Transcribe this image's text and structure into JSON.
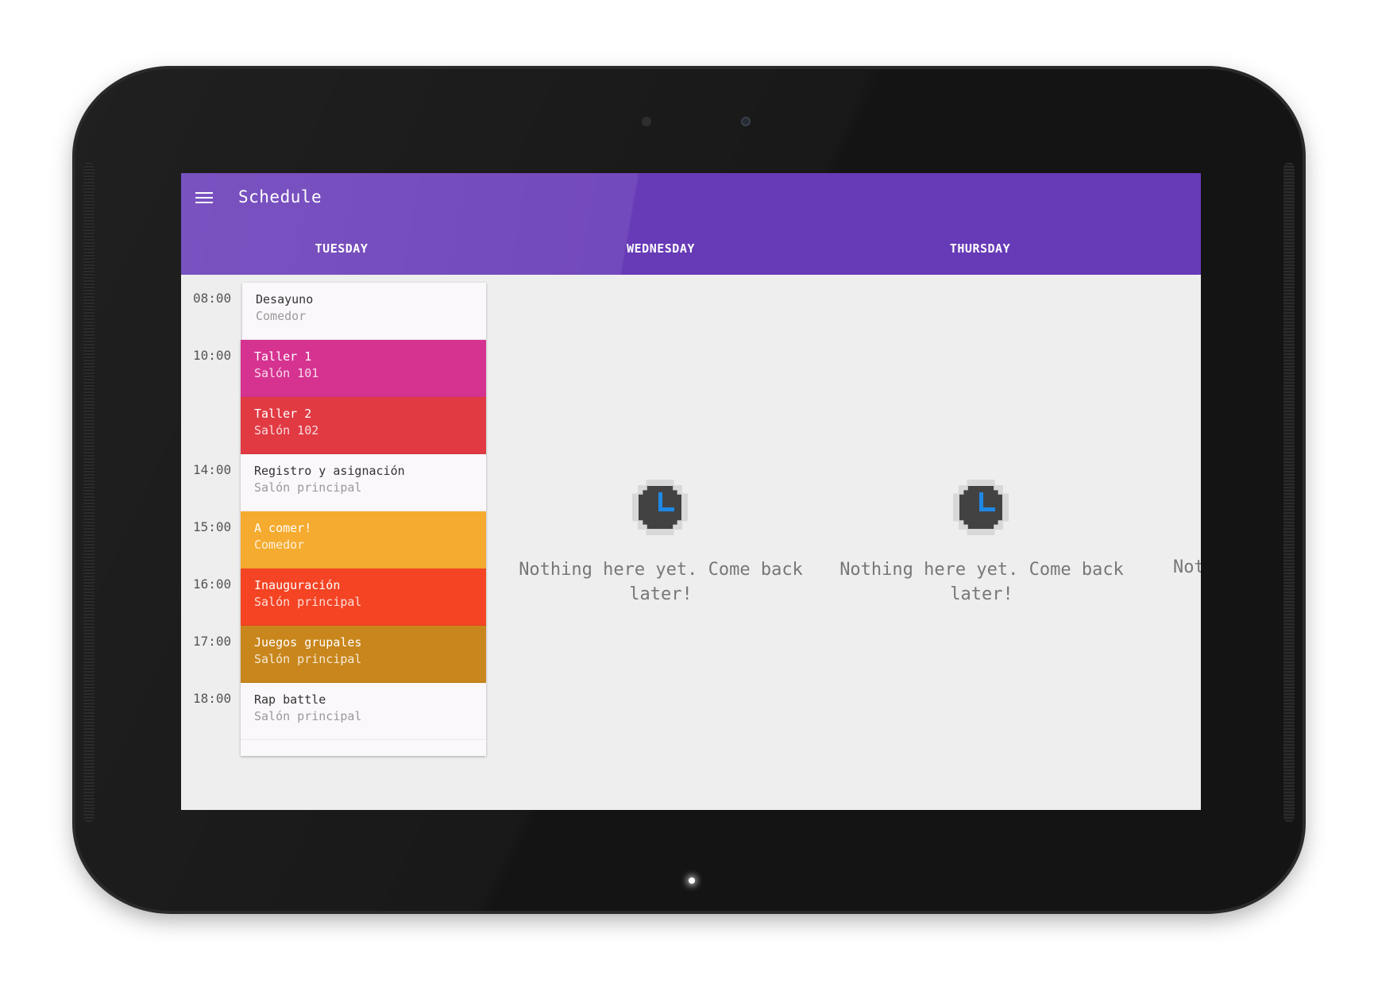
{
  "app": {
    "title": "Schedule",
    "menu_icon": "hamburger-menu-icon",
    "accent_color": "#673ab7"
  },
  "tabs": [
    {
      "label": "TUESDAY"
    },
    {
      "label": "WEDNESDAY"
    },
    {
      "label": "THURSDAY"
    }
  ],
  "tuesday": {
    "times": [
      "08:00",
      "10:00",
      "14:00",
      "15:00",
      "16:00",
      "17:00",
      "18:00"
    ],
    "events": [
      {
        "name": "Desayuno",
        "place": "Comedor",
        "color": "#fbf8fb"
      },
      {
        "name": "Taller 1",
        "place": "Salón 101",
        "color": "#d63391"
      },
      {
        "name": "Taller 2",
        "place": "Salón 102",
        "color": "#e13a43"
      },
      {
        "name": "Registro y asignación",
        "place": "Salón principal",
        "color": "#fbf8fb"
      },
      {
        "name": "A comer!",
        "place": "Comedor",
        "color": "#f5ab2f"
      },
      {
        "name": "Inauguración",
        "place": "Salón principal",
        "color": "#f44424"
      },
      {
        "name": "Juegos grupales",
        "place": "Salón principal",
        "color": "#c8861c"
      },
      {
        "name": "Rap battle",
        "place": "Salón principal",
        "color": "#fbf8fb"
      }
    ]
  },
  "empty_state": {
    "message": "Nothing here yet. Come back later!",
    "partial_message": "Not",
    "icon": "clock-icon"
  }
}
